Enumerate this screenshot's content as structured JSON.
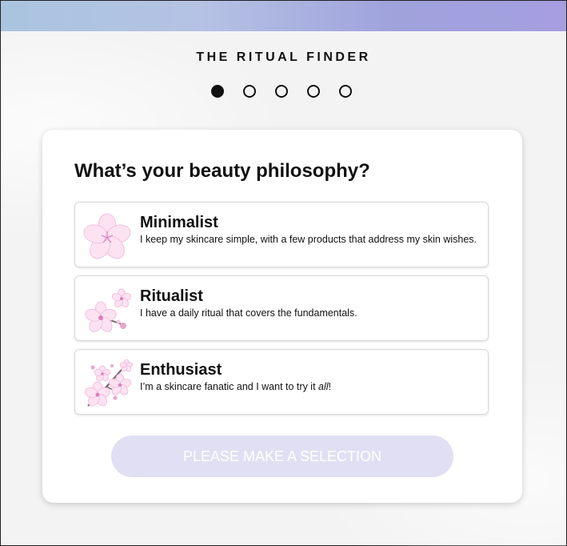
{
  "page": {
    "title": "THE RITUAL FINDER"
  },
  "progress": {
    "current_step": 1,
    "total_steps": 5
  },
  "quiz": {
    "question": "What’s your beauty philosophy?",
    "options": [
      {
        "name": "Minimalist",
        "description": "I keep my skincare simple, with a few products that address my skin wishes.",
        "icon": "single-blossom-icon"
      },
      {
        "name": "Ritualist",
        "description": "I have a daily ritual that covers the fundamentals.",
        "icon": "blossom-pair-icon"
      },
      {
        "name": "Enthusiast",
        "description_prefix": "I’m a skincare fanatic and I want to try it ",
        "description_emphasis": "all",
        "description_suffix": "!",
        "icon": "blossom-branch-icon"
      }
    ],
    "submit_label": "PLEASE MAKE A SELECTION"
  },
  "colors": {
    "topbar_start": "#a9c4e0",
    "topbar_end": "#a69ee0",
    "button_disabled": "#e1dff3",
    "blossom": "#fde3f2"
  }
}
